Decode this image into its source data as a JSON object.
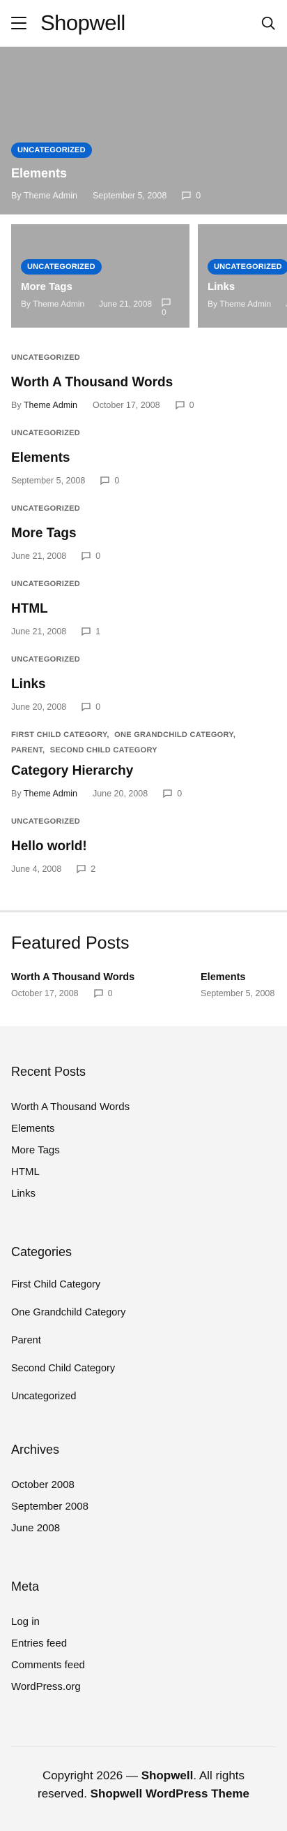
{
  "header": {
    "site_title": "Shopwell"
  },
  "hero": {
    "category": "Uncategorized",
    "title": "Elements",
    "author": "By Theme Admin",
    "date": "September 5, 2008",
    "comments": "0"
  },
  "cards": [
    {
      "category": "Uncategorized",
      "title": "More Tags",
      "author": "By Theme Admin",
      "date": "June 21, 2008",
      "comments": "0"
    },
    {
      "category": "Uncategorized",
      "title": "Links",
      "author": "By Theme Admin",
      "date": "J",
      "comments": ""
    }
  ],
  "posts": [
    {
      "categories": [
        "Uncategorized"
      ],
      "title": "Worth A Thousand Words",
      "author_prefix": "By",
      "author": "Theme Admin",
      "date": "October 17, 2008",
      "comments": "0"
    },
    {
      "categories": [
        "Uncategorized"
      ],
      "title": "Elements",
      "date": "September 5, 2008",
      "comments": "0"
    },
    {
      "categories": [
        "Uncategorized"
      ],
      "title": "More Tags",
      "date": "June 21, 2008",
      "comments": "0"
    },
    {
      "categories": [
        "Uncategorized"
      ],
      "title": "HTML",
      "date": "June 21, 2008",
      "comments": "1"
    },
    {
      "categories": [
        "Uncategorized"
      ],
      "title": "Links",
      "date": "June 20, 2008",
      "comments": "0"
    },
    {
      "categories": [
        "First Child Category,",
        "One Grandchild Category,",
        "Parent,",
        "Second Child Category"
      ],
      "title": "Category Hierarchy",
      "author_prefix": "By",
      "author": "Theme Admin",
      "date": "June 20, 2008",
      "comments": "0"
    },
    {
      "categories": [
        "Uncategorized"
      ],
      "title": "Hello world!",
      "date": "June 4, 2008",
      "comments": "2"
    }
  ],
  "featured": {
    "heading": "Featured Posts",
    "items": [
      {
        "title": "Worth A Thousand Words",
        "date": "October 17, 2008",
        "comments": "0"
      },
      {
        "title": "Elements",
        "date": "September 5, 2008",
        "comments": ""
      }
    ]
  },
  "recent": {
    "heading": "Recent Posts",
    "items": [
      "Worth A Thousand Words",
      "Elements",
      "More Tags",
      "HTML",
      "Links"
    ]
  },
  "categories": {
    "heading": "Categories",
    "items": [
      "First Child Category",
      "One Grandchild Category",
      "Parent",
      "Second Child Category",
      "Uncategorized"
    ]
  },
  "archives": {
    "heading": "Archives",
    "items": [
      "October 2008",
      "September 2008",
      "June 2008"
    ]
  },
  "meta": {
    "heading": "Meta",
    "items": [
      "Log in",
      "Entries feed",
      "Comments feed",
      "WordPress.org"
    ]
  },
  "footer": {
    "copyright": "Copyright 2026 — ",
    "site": "Shopwell",
    "rights": ". All rights reserved. ",
    "theme": "Shopwell WordPress Theme"
  },
  "colors": {
    "badge": "#0b63ce",
    "hero_bg": "#a9a9a9",
    "widgets_bg": "#f3f4f3"
  }
}
